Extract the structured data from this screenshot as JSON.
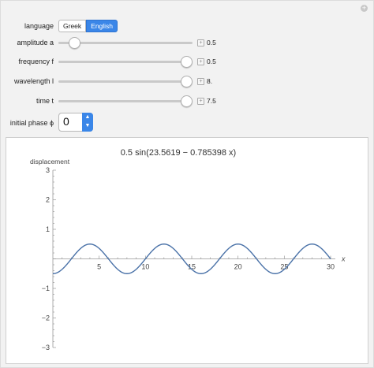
{
  "controls": {
    "language": {
      "label": "language",
      "options": [
        "Greek",
        "English"
      ],
      "selected": "English"
    },
    "sliders": [
      {
        "label": "amplitude a",
        "value_text": "0.5",
        "fraction": 0.12
      },
      {
        "label": "frequency f",
        "value_text": "0.5",
        "fraction": 0.95
      },
      {
        "label": "wavelength l",
        "value_text": "8.",
        "fraction": 0.95
      },
      {
        "label": "time t",
        "value_text": "7.5",
        "fraction": 0.95
      }
    ],
    "phase": {
      "label": "initial phase ϕ",
      "value": "0"
    }
  },
  "chart_data": {
    "type": "line",
    "title": "0.5 sin(23.5619 − 0.785398 x)",
    "xlabel": "x",
    "ylabel": "displacement",
    "xlim": [
      0,
      30
    ],
    "ylim": [
      -3,
      3
    ],
    "x_ticks": [
      "5",
      "10",
      "15",
      "20",
      "25",
      "30"
    ],
    "y_ticks": [
      "3",
      "2",
      "1",
      "−1",
      "−2",
      "−3"
    ],
    "series": [
      {
        "function": "0.5*sin(23.5619 - 0.785398*x)",
        "x_range": [
          0,
          30
        ],
        "amplitude": 0.5
      }
    ],
    "color": "#4a72a8"
  }
}
